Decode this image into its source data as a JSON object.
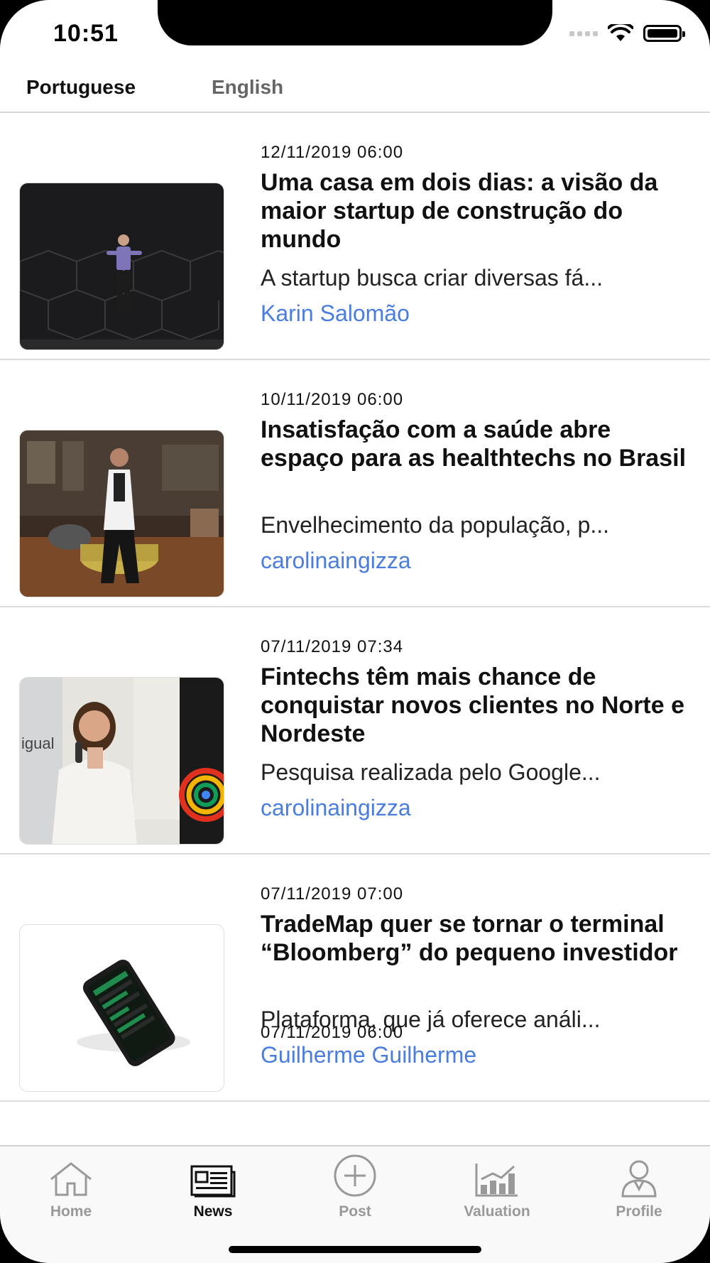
{
  "status_bar": {
    "time": "10:51"
  },
  "language_tabs": {
    "selected": "Portuguese",
    "other": "English"
  },
  "articles": [
    {
      "date": "12/11/2019 06:00",
      "title": "Uma casa em dois dias: a visão da maior startup de construção do mundo",
      "summary": "A startup busca criar diversas fá...",
      "author": "Karin Salomão"
    },
    {
      "date": "10/11/2019 06:00",
      "title": "Insatisfação com a saúde abre espaço para as healthtechs no Brasil",
      "summary": "Envelhecimento da população, p...",
      "author": "carolinaingizza"
    },
    {
      "date": "07/11/2019 07:34",
      "title": "Fintechs têm mais chance de conquistar novos clientes no Norte e Nordeste",
      "summary": "Pesquisa realizada pelo Google...",
      "author": "carolinaingizza"
    },
    {
      "date": "07/11/2019 07:00",
      "title": "TradeMap quer se tornar o terminal “Bloomberg” do pequeno investidor",
      "summary": "Plataforma, que já oferece análi...",
      "author": "Guilherme Guilherme"
    }
  ],
  "peek_date": "07/11/2019 06:00",
  "tab_bar": {
    "home": "Home",
    "news": "News",
    "post": "Post",
    "valuation": "Valuation",
    "profile": "Profile",
    "active": "News"
  },
  "colors": {
    "author_link": "#4a7de0",
    "active_tab": "#111111",
    "inactive_tab": "#999999"
  }
}
